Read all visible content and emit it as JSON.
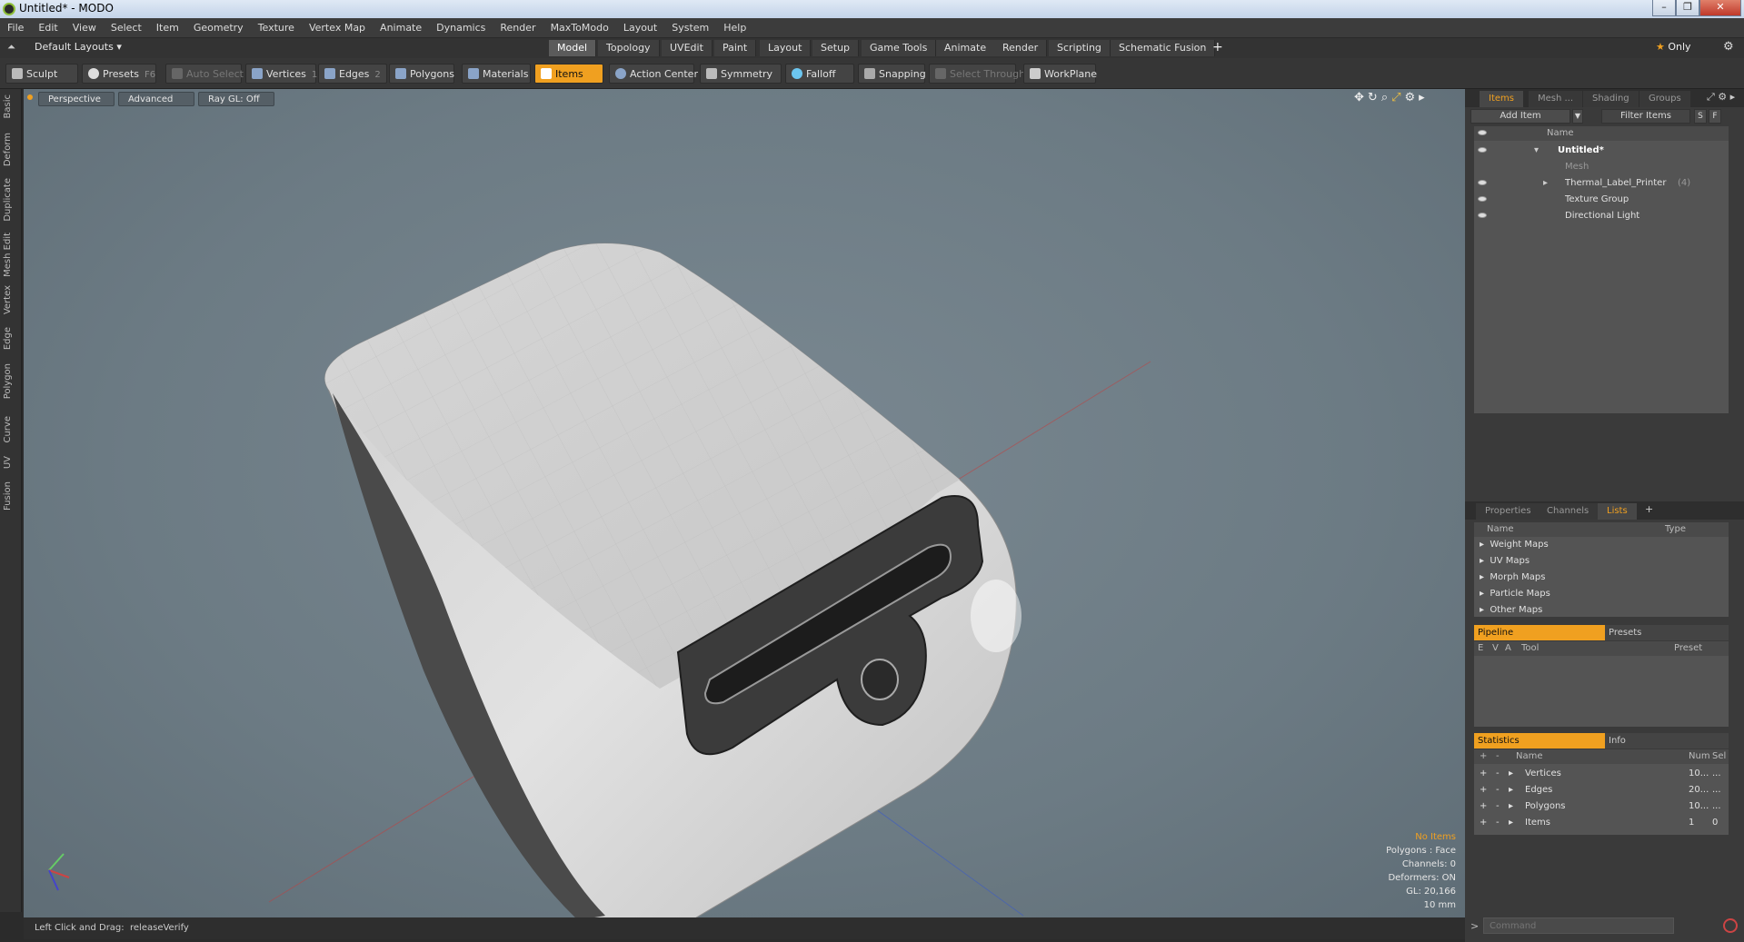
{
  "window": {
    "title": "Untitled* - MODO"
  },
  "menu": [
    "File",
    "Edit",
    "View",
    "Select",
    "Item",
    "Geometry",
    "Texture",
    "Vertex Map",
    "Animate",
    "Dynamics",
    "Render",
    "MaxToModo",
    "Layout",
    "System",
    "Help"
  ],
  "layout_bar": {
    "layout_select": "Default Layouts",
    "tabs": [
      "Model",
      "Topology",
      "UVEdit",
      "Paint",
      "Layout",
      "Setup",
      "Game Tools",
      "Animate",
      "Render",
      "Scripting",
      "Schematic Fusion"
    ],
    "active_tab": "Model",
    "add": "+",
    "only": "Only"
  },
  "toolbar": {
    "sculpt": "Sculpt",
    "presets": "Presets",
    "presets_key": "F6",
    "auto_select": "Auto Select",
    "vertices": "Vertices",
    "vertices_key": "1",
    "edges": "Edges",
    "edges_key": "2",
    "polygons": "Polygons",
    "materials": "Materials",
    "items": "Items",
    "action_center": "Action Center",
    "symmetry": "Symmetry",
    "falloff": "Falloff",
    "snapping": "Snapping",
    "select_through": "Select Through",
    "workplane": "WorkPlane"
  },
  "left_tabs": [
    "Basic",
    "Deform",
    "Duplicate",
    "Mesh Edit",
    "Vertex",
    "Edge",
    "Polygon",
    "Curve",
    "UV",
    "Fusion"
  ],
  "viewport": {
    "perspective": "Perspective",
    "advanced": "Advanced",
    "raygl": "Ray GL: Off",
    "stats": {
      "no_items": "No Items",
      "polygons": "Polygons : Face",
      "channels": "Channels: 0",
      "deformers": "Deformers: ON",
      "gl": "GL: 20,166",
      "scale": "10 mm"
    }
  },
  "status": {
    "hint": "Left Click and Drag:",
    "action": "releaseVerify"
  },
  "items_panel": {
    "tabs": [
      "Items",
      "Mesh ...",
      "Shading",
      "Groups"
    ],
    "add_item": "Add Item",
    "filter": "Filter Items",
    "s": "S",
    "f": "F",
    "col_name": "Name",
    "tree": [
      {
        "label": "Untitled*",
        "level": 0
      },
      {
        "label": "Mesh",
        "level": 1
      },
      {
        "label": "Thermal_Label_Printer",
        "count": "(4)",
        "level": 1
      },
      {
        "label": "Texture Group",
        "level": 1
      },
      {
        "label": "Directional Light",
        "level": 1
      }
    ]
  },
  "lists_panel": {
    "tabs": [
      "Properties",
      "Channels",
      "Lists"
    ],
    "add": "+",
    "col_name": "Name",
    "col_type": "Type",
    "rows": [
      "Weight Maps",
      "UV Maps",
      "Morph Maps",
      "Particle Maps",
      "Other Maps"
    ]
  },
  "pipeline_panel": {
    "tabs": [
      "Pipeline",
      "Presets"
    ],
    "cols": [
      "E",
      "V",
      "A",
      "Tool",
      "Preset"
    ]
  },
  "stats_panel": {
    "tabs": [
      "Statistics",
      "Info"
    ],
    "cols": [
      "+",
      "-",
      "Name",
      "Num",
      "Sel"
    ],
    "rows": [
      {
        "name": "Vertices",
        "num": "10...",
        "sel": "..."
      },
      {
        "name": "Edges",
        "num": "20...",
        "sel": "..."
      },
      {
        "name": "Polygons",
        "num": "10...",
        "sel": "..."
      },
      {
        "name": "Items",
        "num": "1",
        "sel": "0"
      }
    ]
  },
  "command": {
    "placeholder": "Command"
  },
  "colors": {
    "accent": "#f0a020",
    "viewport_bg": "#6c7b84"
  }
}
